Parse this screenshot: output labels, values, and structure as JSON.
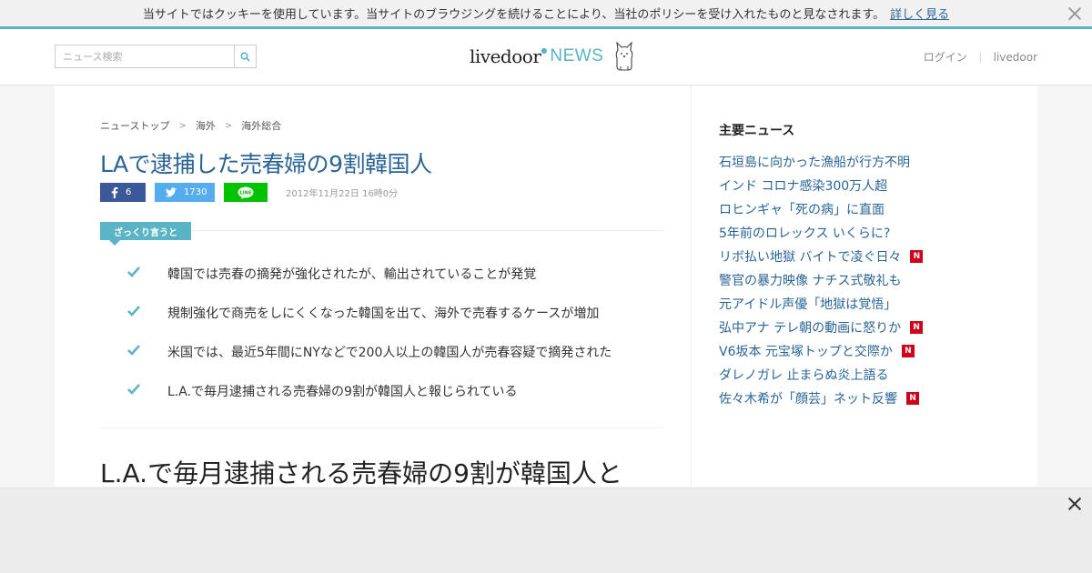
{
  "cookie_bar": {
    "message": "当サイトではクッキーを使用しています。当サイトのブラウジングを続けることにより、当社のポリシーを受け入れたものと見なされます。",
    "more_link": "詳しく見る",
    "close_icon": "close-icon"
  },
  "header": {
    "search_placeholder": "ニュース検索",
    "search_icon": "search-icon",
    "logo_text": "livedoor",
    "logo_news": "NEWS",
    "logo_dot": "●",
    "links": [
      "ログイン",
      "livedoor"
    ]
  },
  "breadcrumb": [
    "ニューストップ",
    "海外",
    "海外総合"
  ],
  "article": {
    "title": "LAで逮捕した売春婦の9割韓国人",
    "share": {
      "facebook_count": "6",
      "twitter_count": "1730",
      "line_label": "LINE"
    },
    "date": "2012年11月22日 16時0分",
    "summary_tag": "ざっくり言うと",
    "summary": [
      "韓国では売春の摘発が強化されたが、輸出されていることが発覚",
      "規制強化で商売をしにくくなった韓国を出て、海外で売春するケースが増加",
      "米国では、最近5年間にNYなどで200人以上の韓国人が売春容疑で摘発された",
      "L.A.で毎月逮捕される売春婦の9割が韓国人と報じられている"
    ],
    "headline2": "L.A.で毎月逮捕される売春婦の9割が韓国人と"
  },
  "sidebar": {
    "title": "主要ニュース",
    "badge_label": "N",
    "items": [
      {
        "label": "石垣島に向かった漁船が行方不明",
        "new": false
      },
      {
        "label": "インド コロナ感染300万人超",
        "new": false
      },
      {
        "label": "ロヒンギャ「死の病」に直面",
        "new": false
      },
      {
        "label": "5年前のロレックス いくらに?",
        "new": false
      },
      {
        "label": "リボ払い地獄 バイトで凌ぐ日々",
        "new": true
      },
      {
        "label": "警官の暴力映像 ナチス式敬礼も",
        "new": false
      },
      {
        "label": "元アイドル声優「地獄は覚悟」",
        "new": false
      },
      {
        "label": "弘中アナ テレ朝の動画に怒りか",
        "new": true
      },
      {
        "label": "V6坂本 元宝塚トップと交際か",
        "new": true
      },
      {
        "label": "ダレノガレ 止まらぬ炎上語る",
        "new": false
      },
      {
        "label": "佐々木希が「顔芸」ネット反響",
        "new": true
      }
    ]
  },
  "colors": {
    "accent": "#5ab4c5",
    "link": "#2a6496",
    "facebook": "#3b5998",
    "twitter": "#55acee",
    "line": "#00c300",
    "badge": "#d0021b"
  }
}
